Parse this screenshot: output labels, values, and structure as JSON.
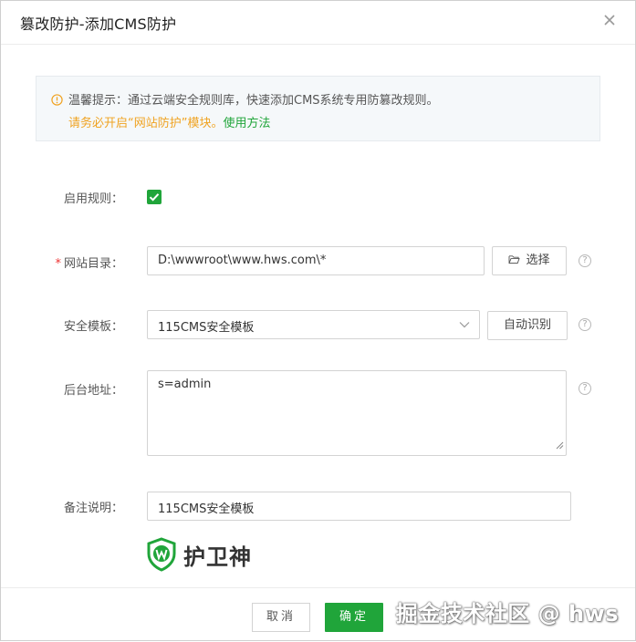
{
  "dialog": {
    "title": "篡改防护-添加CMS防护",
    "close_icon": "close-icon"
  },
  "tip": {
    "icon": "warning-circle-icon",
    "line1": "温馨提示：通过云端安全规则库，快速添加CMS系统专用防篡改规则。",
    "line2_prefix": "请务必开启“网站防护”模块。",
    "help_link": "使用方法"
  },
  "form": {
    "enable_rule": {
      "label": "启用规则：",
      "checked": true
    },
    "site_dir": {
      "required_mark": "*",
      "label": "网站目录：",
      "value": "D:\\wwwroot\\www.hws.com\\*",
      "select_button": "选择"
    },
    "template": {
      "label": "安全模板：",
      "value": "115CMS安全模板",
      "auto_detect_button": "自动识别"
    },
    "backend": {
      "label": "后台地址：",
      "value": "s=admin"
    },
    "remark": {
      "label": "备注说明：",
      "value": "115CMS安全模板"
    },
    "help_icon": "?"
  },
  "logo": {
    "text": "护卫神"
  },
  "footer": {
    "cancel": "取消",
    "ok": "确定"
  },
  "watermark": "掘金技术社区 @ hws",
  "colors": {
    "accent": "#20a53a",
    "warning": "#f0a322",
    "required": "#e33333"
  }
}
